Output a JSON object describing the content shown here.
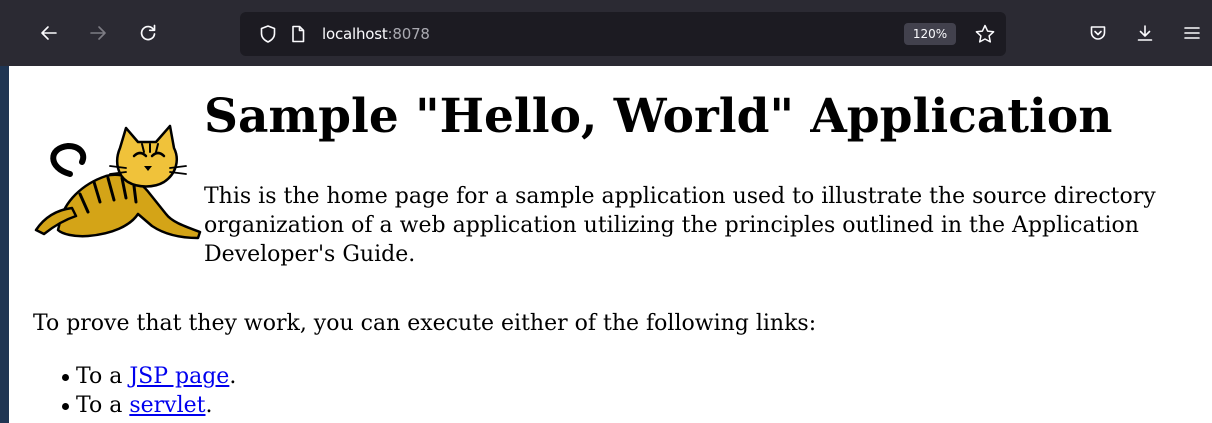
{
  "browser": {
    "url_host": "localhost",
    "url_port": ":8078",
    "zoom_label": "120%"
  },
  "toolbar_icons": [
    "back-arrow-icon",
    "forward-arrow-icon",
    "reload-icon",
    "shield-icon",
    "page-icon",
    "star-icon",
    "pocket-icon",
    "download-icon",
    "menu-icon"
  ],
  "page": {
    "heading": "Sample \"Hello, World\" Application",
    "intro": "This is the home page for a sample application used to illustrate the source directory organization of a web application utilizing the principles outlined in the Application Developer's Guide.",
    "prove_text": "To prove that they work, you can execute either of the following links:",
    "links": [
      {
        "prefix": "To a ",
        "label": "JSP page",
        "suffix": "."
      },
      {
        "prefix": "To a ",
        "label": "servlet",
        "suffix": "."
      }
    ]
  },
  "colors": {
    "toolbar_bg": "#2b2a33",
    "urlbar_bg": "#1c1b22",
    "link": "#0000ee",
    "page_border": "#1f3553"
  }
}
